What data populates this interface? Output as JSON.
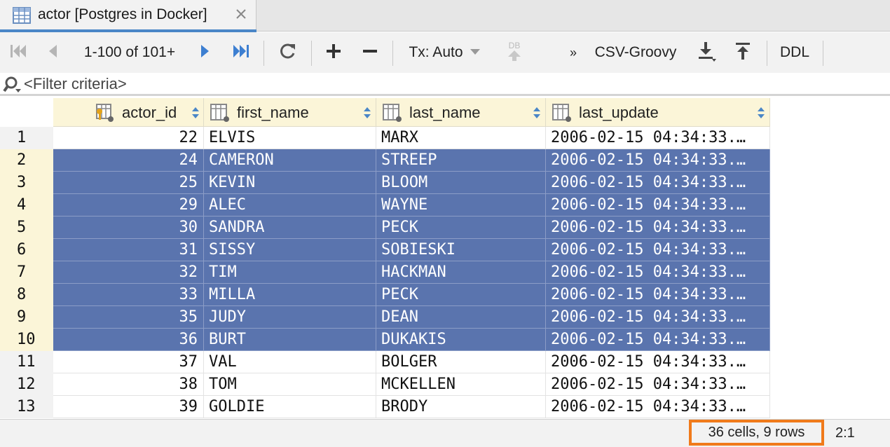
{
  "tab": {
    "title": "actor [Postgres in Docker]",
    "icon": "table-icon",
    "close_icon": "close-icon"
  },
  "toolbar": {
    "page_range": "1-100 of 101+",
    "tx_mode": "Tx: Auto",
    "db_label": "DB",
    "more_label": "»",
    "export_format": "CSV-Groovy",
    "ddl_label": "DDL"
  },
  "filter": {
    "placeholder": "<Filter criteria>"
  },
  "grid": {
    "columns": [
      {
        "label": "actor_id",
        "icon": "primary-key-column-icon"
      },
      {
        "label": "first_name",
        "icon": "column-icon"
      },
      {
        "label": "last_name",
        "icon": "column-icon"
      },
      {
        "label": "last_update",
        "icon": "column-icon"
      }
    ],
    "rows": [
      {
        "num": "1",
        "actor_id": "22",
        "first_name": "ELVIS",
        "last_name": "MARX",
        "last_update": "2006-02-15 04:34:33.…",
        "selected": false
      },
      {
        "num": "2",
        "actor_id": "24",
        "first_name": "CAMERON",
        "last_name": "STREEP",
        "last_update": "2006-02-15 04:34:33.…",
        "selected": true
      },
      {
        "num": "3",
        "actor_id": "25",
        "first_name": "KEVIN",
        "last_name": "BLOOM",
        "last_update": "2006-02-15 04:34:33.…",
        "selected": true
      },
      {
        "num": "4",
        "actor_id": "29",
        "first_name": "ALEC",
        "last_name": "WAYNE",
        "last_update": "2006-02-15 04:34:33.…",
        "selected": true
      },
      {
        "num": "5",
        "actor_id": "30",
        "first_name": "SANDRA",
        "last_name": "PECK",
        "last_update": "2006-02-15 04:34:33.…",
        "selected": true
      },
      {
        "num": "6",
        "actor_id": "31",
        "first_name": "SISSY",
        "last_name": "SOBIESKI",
        "last_update": "2006-02-15 04:34:33.…",
        "selected": true
      },
      {
        "num": "7",
        "actor_id": "32",
        "first_name": "TIM",
        "last_name": "HACKMAN",
        "last_update": "2006-02-15 04:34:33.…",
        "selected": true
      },
      {
        "num": "8",
        "actor_id": "33",
        "first_name": "MILLA",
        "last_name": "PECK",
        "last_update": "2006-02-15 04:34:33.…",
        "selected": true
      },
      {
        "num": "9",
        "actor_id": "35",
        "first_name": "JUDY",
        "last_name": "DEAN",
        "last_update": "2006-02-15 04:34:33.…",
        "selected": true
      },
      {
        "num": "10",
        "actor_id": "36",
        "first_name": "BURT",
        "last_name": "DUKAKIS",
        "last_update": "2006-02-15 04:34:33.…",
        "selected": true
      },
      {
        "num": "11",
        "actor_id": "37",
        "first_name": "VAL",
        "last_name": "BOLGER",
        "last_update": "2006-02-15 04:34:33.…",
        "selected": false
      },
      {
        "num": "12",
        "actor_id": "38",
        "first_name": "TOM",
        "last_name": "MCKELLEN",
        "last_update": "2006-02-15 04:34:33.…",
        "selected": false
      },
      {
        "num": "13",
        "actor_id": "39",
        "first_name": "GOLDIE",
        "last_name": "BRODY",
        "last_update": "2006-02-15 04:34:33.…",
        "selected": false
      }
    ]
  },
  "status": {
    "selection_summary": "36 cells, 9 rows",
    "cursor_position": "2:1"
  },
  "colors": {
    "selection": "#5a74ae",
    "header_bg": "#fbf5d8",
    "highlight_border": "#f07a1a",
    "accent": "#4a86c7"
  }
}
